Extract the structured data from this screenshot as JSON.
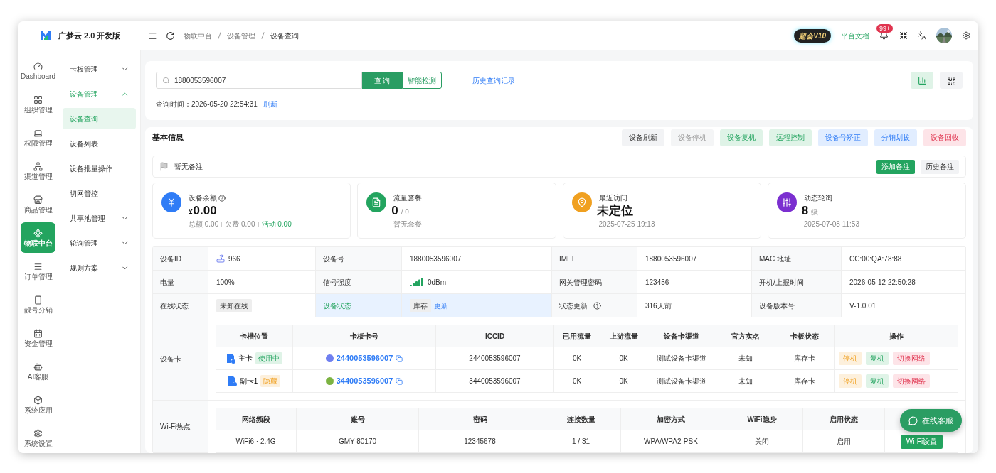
{
  "app": {
    "logo_text": "广梦云 2.0 开发版"
  },
  "rail": [
    {
      "label": "Dashboard",
      "selected": false
    },
    {
      "label": "组织管理",
      "selected": false
    },
    {
      "label": "权限管理",
      "selected": false
    },
    {
      "label": "渠道管理",
      "selected": false
    },
    {
      "label": "商品管理",
      "selected": false
    },
    {
      "label": "物联中台",
      "selected": true
    },
    {
      "label": "订单管理",
      "selected": false
    },
    {
      "label": "靓号分销",
      "selected": false
    },
    {
      "label": "资金管理",
      "selected": false
    },
    {
      "label": "AI客服",
      "selected": false
    },
    {
      "label": "系统应用",
      "selected": false
    },
    {
      "label": "系统设置",
      "selected": false
    }
  ],
  "submenu": [
    {
      "label": "卡板管理",
      "expanded": false
    },
    {
      "label": "设备管理",
      "expanded": true,
      "children": [
        {
          "label": "设备查询",
          "selected": true
        },
        {
          "label": "设备列表",
          "selected": false
        },
        {
          "label": "设备批量操作",
          "selected": false
        },
        {
          "label": "切网管控",
          "selected": false
        }
      ]
    },
    {
      "label": "共享池管理",
      "expanded": false
    },
    {
      "label": "轮询管理",
      "expanded": false
    },
    {
      "label": "规则方案",
      "expanded": false
    }
  ],
  "header": {
    "breadcrumbs": [
      "物联中台",
      "设备管理",
      "设备查询"
    ],
    "vip_badge": "超会V10",
    "docs_link": "平台文档",
    "notification_count": "99+"
  },
  "search": {
    "value": "1880053596007",
    "query_button": "查 询",
    "detect_button": "智能检测",
    "history_link": "历史查询记录",
    "query_time_label": "查询时间：",
    "query_time": "2026-05-20 22:54:31",
    "refresh_link": "刷新"
  },
  "basic_info": {
    "title": "基本信息",
    "actions": [
      {
        "label": "设备刷新",
        "color": "#f2f3f5"
      },
      {
        "label": "设备停机",
        "color": "#f4f5f6"
      },
      {
        "label": "设备复机",
        "color": "#dff3e7"
      },
      {
        "label": "远程控制",
        "color": "#dff3e7"
      },
      {
        "label": "设备号矫正",
        "color": "#e1edff"
      },
      {
        "label": "分销划拨",
        "color": "#e1edff"
      },
      {
        "label": "设备回收",
        "color": "#fde4e8"
      }
    ],
    "note": {
      "text": "暂无备注",
      "add_button": "添加备注",
      "history_button": "历史备注"
    },
    "stats": [
      {
        "title": "设备余额",
        "help": true,
        "prefix": "¥",
        "value": "0.00",
        "color": "#2f7cf6",
        "sub": [
          {
            "text": "总额 0.00",
            "highlight": false
          },
          {
            "text": "欠费 0.00",
            "highlight": false
          },
          {
            "text": "活动 0.00",
            "highlight": true
          }
        ]
      },
      {
        "title": "流量套餐",
        "help": false,
        "value": "0",
        "unit": "/ 0",
        "color": "#23a45f",
        "sub": [
          {
            "text": "暂无套餐",
            "highlight": false
          }
        ]
      },
      {
        "title": "最近访问",
        "help": false,
        "value": "未定位",
        "color": "#f0a020",
        "sub": [
          {
            "text": "2025-07-25 19:13",
            "highlight": false
          }
        ]
      },
      {
        "title": "动态轮询",
        "help": false,
        "value": "8",
        "unit": "级",
        "color": "#7b2fd0",
        "sub": [
          {
            "text": "2025-07-08 11:53",
            "highlight": false
          }
        ]
      }
    ],
    "fields": [
      [
        {
          "label": "设备ID",
          "value": "966",
          "kind": "device"
        },
        {
          "label": "设备号",
          "value": "1880053596007",
          "kind": "text"
        },
        {
          "label": "IMEI",
          "value": "1880053596007",
          "kind": "text"
        },
        {
          "label": "MAC 地址",
          "value": "CC:00:QA:78:88",
          "kind": "text"
        }
      ],
      [
        {
          "label": "电量",
          "value": "100%",
          "kind": "text"
        },
        {
          "label": "信号强度",
          "value": "0dBm",
          "kind": "signal"
        },
        {
          "label": "网关管理密码",
          "value": "123456",
          "kind": "text"
        },
        {
          "label": "开机/上报时间",
          "value": "2026-05-12 22:50:28",
          "kind": "text"
        }
      ],
      [
        {
          "label": "在线状态",
          "value": "未知在线",
          "kind": "tag"
        },
        {
          "label": "设备状态",
          "value": "库存",
          "link": "更新",
          "kind": "stock",
          "highlighted": true
        },
        {
          "label": "状态更新",
          "help": true,
          "value": "316天前",
          "kind": "text"
        },
        {
          "label": "设备版本号",
          "value": "V-1.0.01",
          "kind": "text"
        }
      ]
    ],
    "cards": {
      "label": "设备卡",
      "columns": [
        "卡槽位置",
        "卡板卡号",
        "ICCID",
        "已用流量",
        "上游流量",
        "设备卡渠道",
        "官方实名",
        "卡板状态",
        "操作"
      ],
      "rows": [
        {
          "slot": "主卡",
          "slot_tag": {
            "text": "使用中",
            "color": "#dff3e7"
          },
          "card": {
            "number": "2440053596007",
            "color": "#6f7ff0"
          },
          "iccid": "2440053596007",
          "used": "0K",
          "upstream": "0K",
          "channel": "测试设备卡渠道",
          "realname": "未知",
          "state": "库存卡",
          "actions": [
            "停机",
            "复机",
            "切换网络"
          ]
        },
        {
          "slot": "副卡1",
          "slot_tag": {
            "text": "隐藏",
            "color": "#fdf0dc"
          },
          "card": {
            "number": "3440053596007",
            "color": "#7cb342"
          },
          "iccid": "3440053596007",
          "used": "0K",
          "upstream": "0K",
          "channel": "测试设备卡渠道",
          "realname": "未知",
          "state": "库存卡",
          "actions": [
            "停机",
            "复机",
            "切换网络"
          ]
        }
      ]
    },
    "wifi": {
      "label": "Wi-Fi热点",
      "columns": [
        "网络频段",
        "账号",
        "密码",
        "连接数量",
        "加密方式",
        "WiFi隐身",
        "启用状态"
      ],
      "rows": [
        {
          "band": "WiFi6 · 2.4G",
          "account": "GMY-80170",
          "password": "12345678",
          "connections": "1 / 31",
          "encryption": "WPA/WPA2-PSK",
          "hidden": "关闭",
          "enabled": "启用",
          "action": "Wi-Fi设置"
        }
      ]
    }
  },
  "chat_button": "在线客服"
}
